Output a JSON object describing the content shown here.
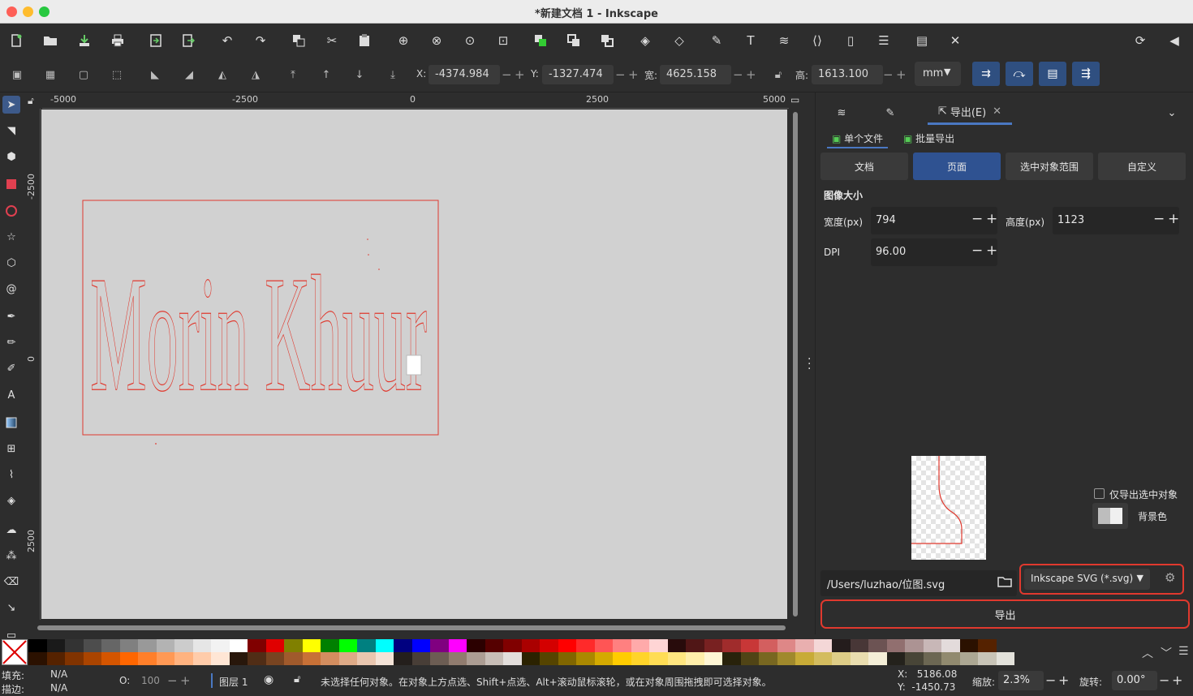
{
  "window": {
    "title": "*新建文档 1 - Inkscape"
  },
  "toolbar": {
    "commands": [
      "new-document-icon",
      "open-icon",
      "save-icon",
      "print-icon",
      "import-icon",
      "export-icon",
      "undo-icon",
      "redo-icon",
      "copy-icon",
      "cut-icon",
      "paste-icon",
      "zoom-selection-icon",
      "zoom-drawing-icon",
      "zoom-page-icon",
      "zoom-page-width-icon",
      "duplicate-icon",
      "clone-icon",
      "unlink-clone-icon",
      "group-icon",
      "ungroup-icon",
      "fill-stroke-icon",
      "text-font-icon",
      "layers-icon",
      "xml-editor-icon",
      "objects-icon",
      "align-icon",
      "document-properties-icon",
      "preferences-icon"
    ]
  },
  "controls": {
    "x_label": "X:",
    "x_value": "-4374.984",
    "y_label": "Y:",
    "y_value": "-1327.474",
    "w_label": "宽:",
    "w_value": "4625.158",
    "h_label": "高:",
    "h_value": "1613.100",
    "unit": "mm"
  },
  "rulers": {
    "top": [
      "-5000",
      "-2500",
      "0",
      "2500",
      "5000"
    ],
    "left": [
      "-2500",
      "0",
      "2500"
    ]
  },
  "canvas": {
    "artwork_text": "Morin Khuur",
    "stroke_color": "#e0392e"
  },
  "panel": {
    "tab_export": "导出(E)",
    "subtab_single": "单个文件",
    "subtab_batch": "批量导出",
    "area_buttons": [
      "文档",
      "页面",
      "选中对象范围",
      "自定义"
    ],
    "image_size_title": "图像大小",
    "width_label": "宽度(px)",
    "width_value": "794",
    "height_label": "高度(px)",
    "height_value": "1123",
    "dpi_label": "DPI",
    "dpi_value": "96.00",
    "export_selected_only": "仅导出选中对象",
    "background_color": "背景色",
    "filename": "/Users/luzhao/位图.svg",
    "format": "Inkscape SVG (*.svg)",
    "export_button": "导出"
  },
  "status": {
    "fill_label": "填充:",
    "fill_value": "N/A",
    "stroke_label": "描边:",
    "stroke_value": "N/A",
    "opacity_label": "O:",
    "opacity_value": "100",
    "layer": "图层 1",
    "message": "未选择任何对象。在对象上方点选、Shift+点选、Alt+滚动鼠标滚轮，或在对象周围拖拽即可选择对象。",
    "cursor_x": "X:   5186.08",
    "cursor_y": "Y:  -1450.73",
    "zoom_label": "缩放:",
    "zoom_value": "2.3%",
    "rotate_label": "旋转:",
    "rotate_value": "0.00°"
  },
  "palette_row1": [
    "#000000",
    "#1a1a1a",
    "#333333",
    "#4d4d4d",
    "#666666",
    "#808080",
    "#999999",
    "#b3b3b3",
    "#cccccc",
    "#e6e6e6",
    "#f2f2f2",
    "#ffffff",
    "#800000",
    "#e00000",
    "#808000",
    "#ffff00",
    "#008000",
    "#00ff00",
    "#008080",
    "#00ffff",
    "#000080",
    "#0000ff",
    "#800080",
    "#ff00ff",
    "#2b0000",
    "#550000",
    "#800000",
    "#aa0000",
    "#d40000",
    "#ff0000",
    "#ff2a2a",
    "#ff5555",
    "#ff8080",
    "#ffaaaa",
    "#ffd5d5",
    "#280b0b",
    "#501616",
    "#782121",
    "#a02c2c",
    "#c83737",
    "#d35f5f",
    "#de8787",
    "#e9afaf",
    "#f4d7d7",
    "#241c1c",
    "#483737",
    "#6c5353",
    "#916f6f",
    "#ac9393",
    "#c8b7b7",
    "#e3dbdb",
    "#2b1100",
    "#552200"
  ],
  "palette_row2": [
    "#2b1100",
    "#552200",
    "#803300",
    "#aa4400",
    "#d45500",
    "#ff6600",
    "#ff7f2a",
    "#ff9955",
    "#ffb380",
    "#ffccaa",
    "#ffe6d5",
    "#28170b",
    "#502d16",
    "#784421",
    "#a05a2c",
    "#c87137",
    "#d38d5f",
    "#deaa87",
    "#e9c6af",
    "#f4e3d7",
    "#241f1c",
    "#483e37",
    "#6c5d53",
    "#917c6f",
    "#ac9d93",
    "#c8beb7",
    "#e3dedb",
    "#2b2200",
    "#554400",
    "#806600",
    "#aa8800",
    "#d4aa00",
    "#ffcc00",
    "#ffd42a",
    "#ffdd55",
    "#ffe680",
    "#ffeeaa",
    "#fff6d5",
    "#28220b",
    "#504416",
    "#786721",
    "#a0892c",
    "#c8ab37",
    "#d3bc5f",
    "#decd87",
    "#e9ddaf",
    "#f4eed7",
    "#24221c",
    "#484537",
    "#6c6753",
    "#918a6f",
    "#aca793",
    "#c8c4b7",
    "#e3e2db"
  ]
}
